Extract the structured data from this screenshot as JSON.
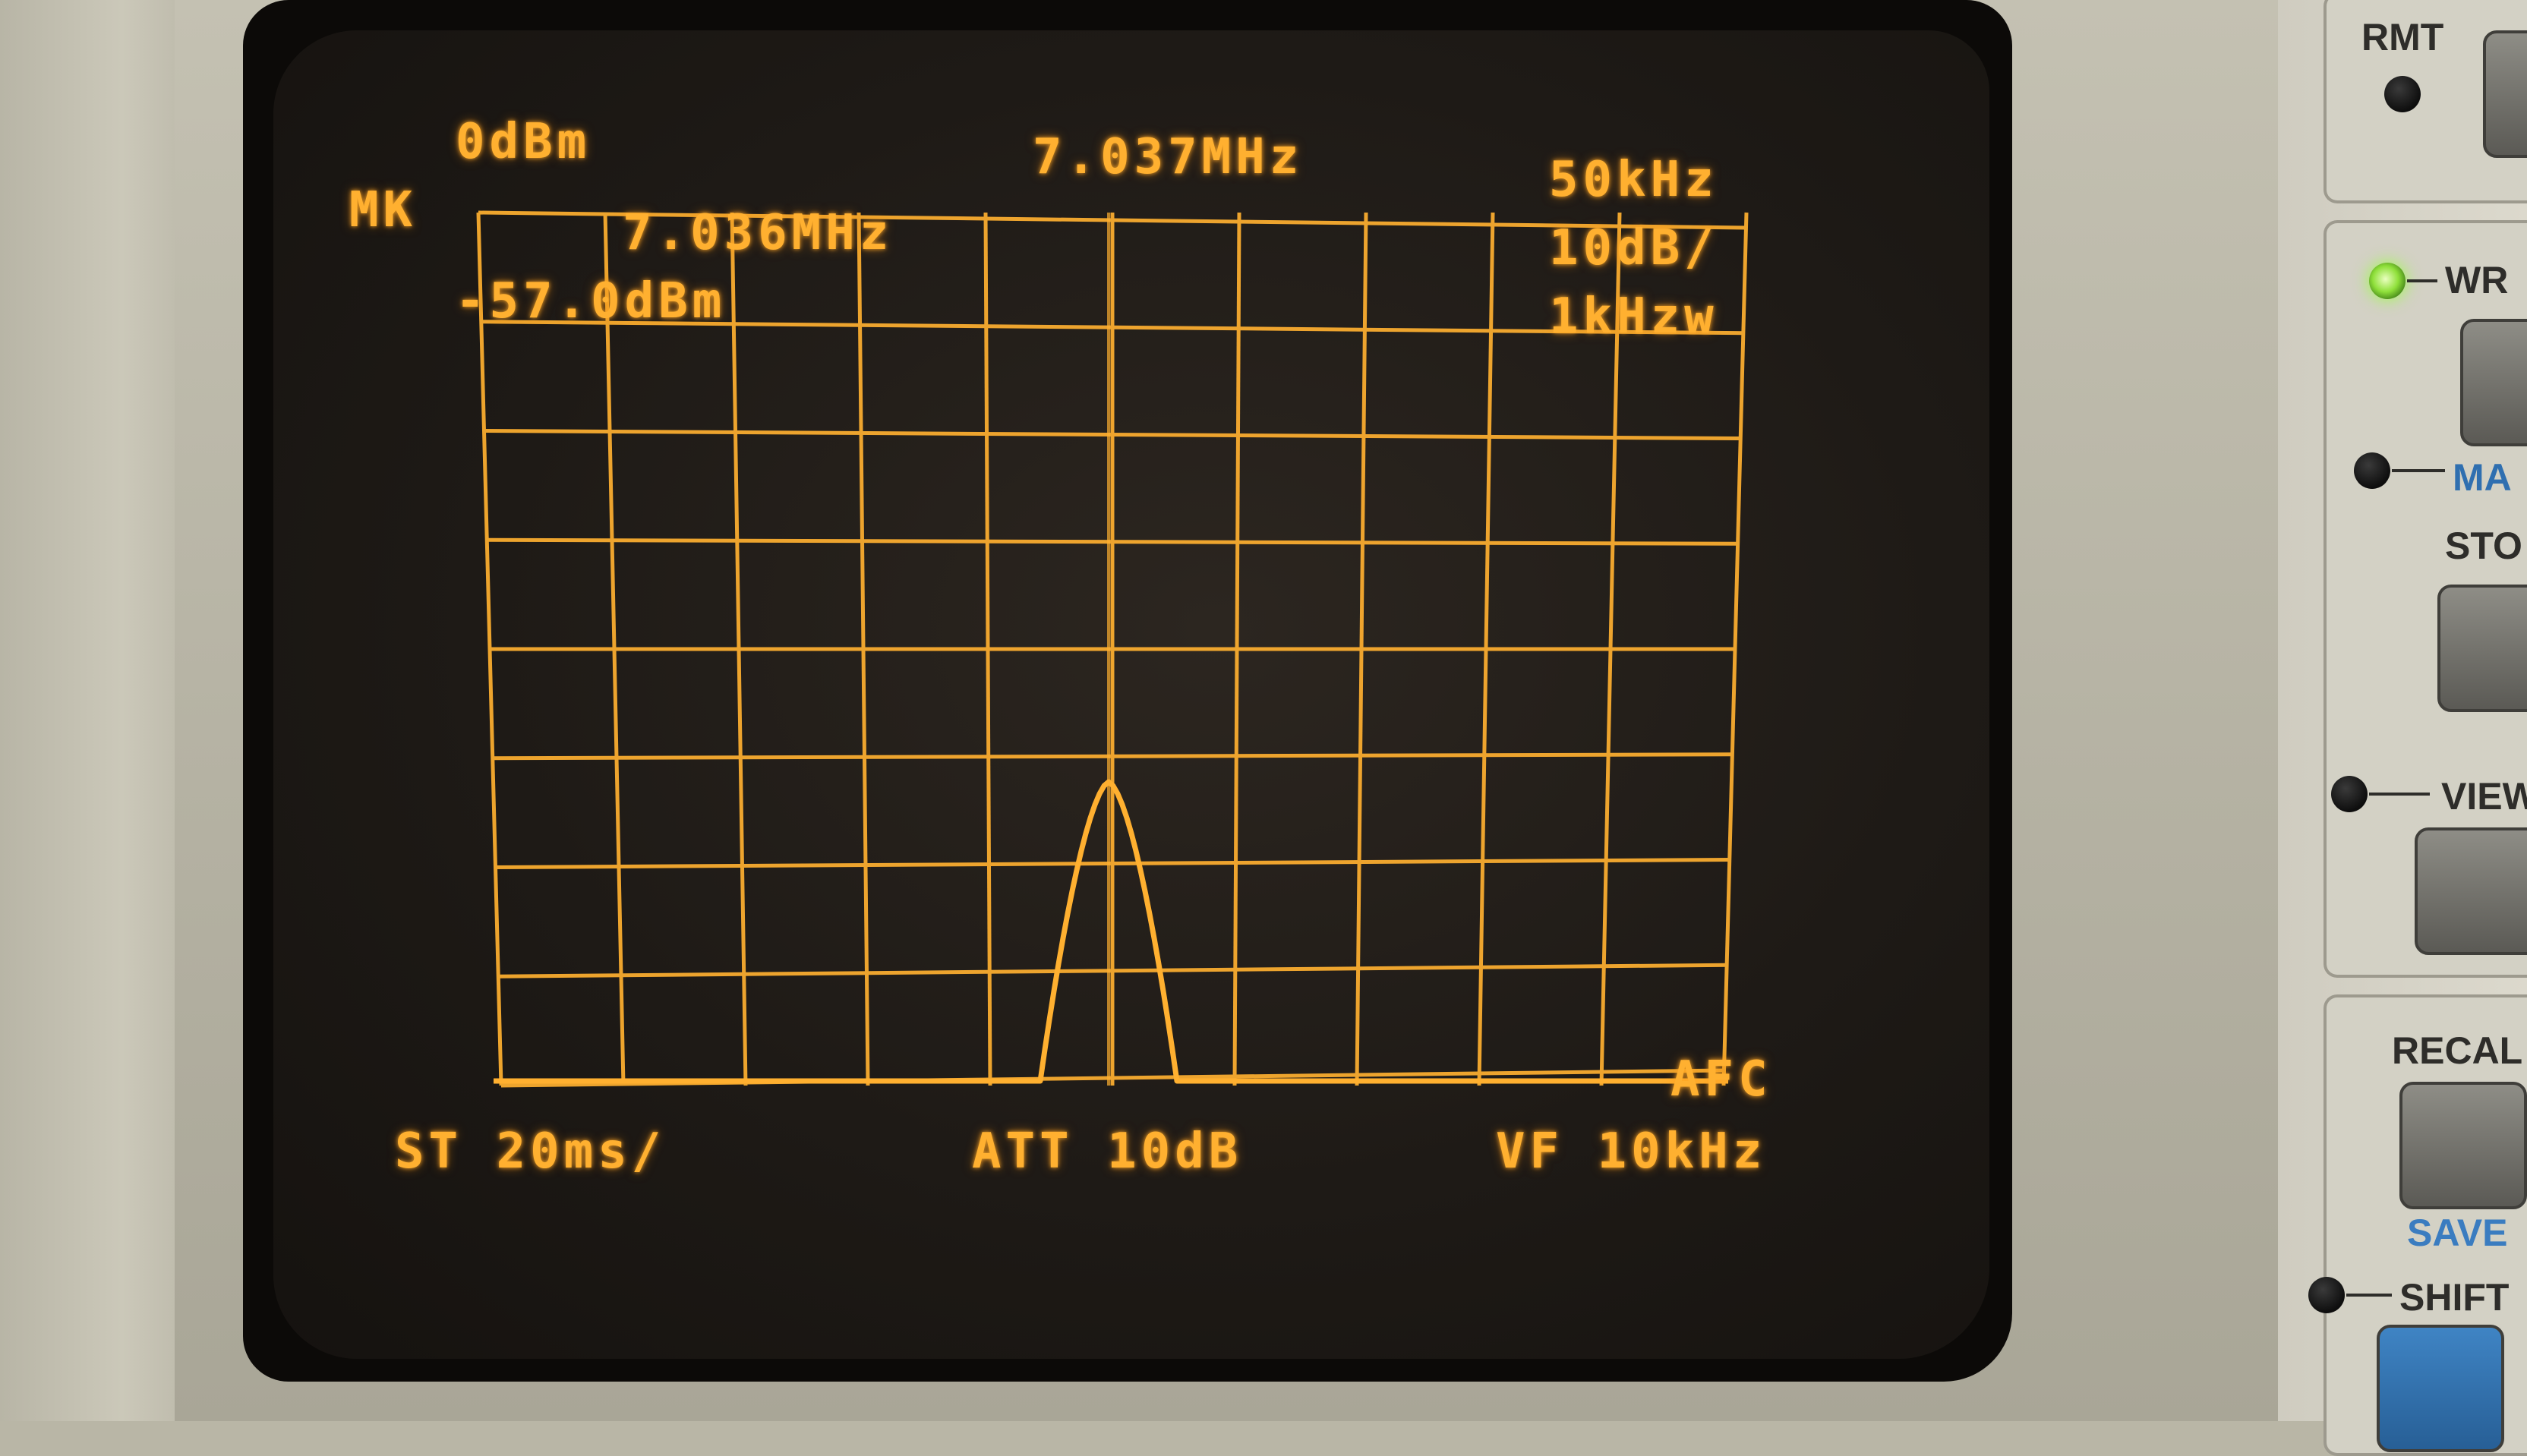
{
  "screen": {
    "ref_level": "0dBm",
    "center_freq": "7.037MHz",
    "span": "50kHz",
    "marker_label": "MK",
    "marker_freq": "7.036MHz",
    "marker_level": "-57.0dBm",
    "scale": "10dB/",
    "rbw": "1kHzw",
    "afc": "AFC",
    "sweep_time": "ST 20ms/",
    "attenuation": "ATT 10dB",
    "video_filter": "VF 10kHz",
    "trace_color": "#ffb030"
  },
  "panel": {
    "rmt": "RMT",
    "wr": "WR",
    "ma": "MA",
    "sto": "STO",
    "view": "VIEW",
    "recall": "RECAL",
    "save": "SAVE",
    "shift": "SHIFT"
  }
}
